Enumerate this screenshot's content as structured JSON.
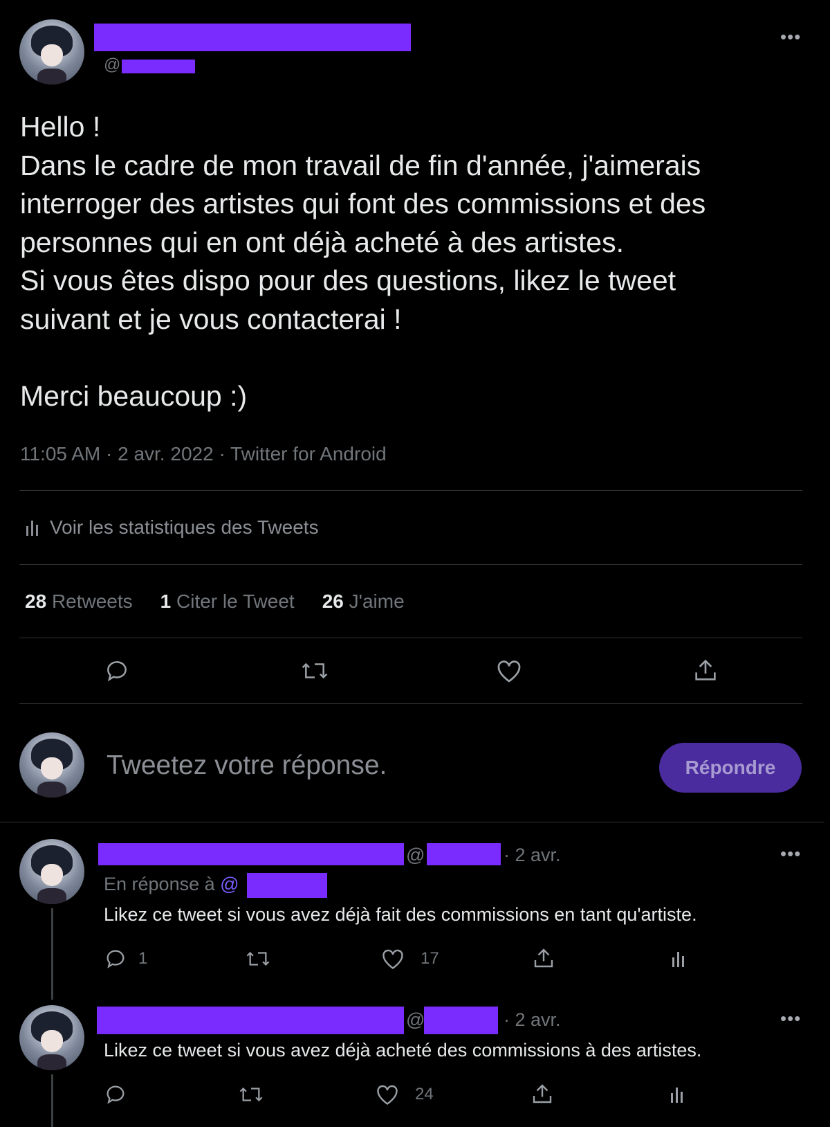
{
  "main_tweet": {
    "handle_prefix": "@",
    "body_lines": [
      "Hello !",
      "Dans le cadre de mon travail de fin d'année, j'aimerais",
      "interroger des artistes qui font des commissions et des",
      "personnes qui en ont déjà acheté à des artistes.",
      "Si vous êtes dispo pour des questions, likez le tweet",
      "suivant et je vous contacterai !",
      "",
      "Merci beaucoup :)"
    ],
    "meta": "11:05 AM · 2 avr. 2022 · Twitter for Android",
    "stats_link": "Voir les statistiques des Tweets",
    "counts": {
      "retweets_num": "28",
      "retweets_label": "Retweets",
      "quotes_num": "1",
      "quotes_label": "Citer le Tweet",
      "likes_num": "26",
      "likes_label": "J'aime"
    }
  },
  "reply_box": {
    "placeholder": "Tweetez votre réponse.",
    "button_label": "Répondre"
  },
  "replies": [
    {
      "at": "@",
      "date": "· 2 avr.",
      "in_reply_prefix": "En réponse à",
      "in_reply_at": "@",
      "text": "Likez ce tweet si vous avez déjà fait des commissions en tant qu'artiste.",
      "reply_count": "1",
      "like_count": "17"
    },
    {
      "at": "@",
      "date": "· 2 avr.",
      "text": "Likez ce tweet si vous avez déjà acheté des commissions à des artistes.",
      "like_count": "24"
    }
  ],
  "colors": {
    "redaction": "#7a2cff",
    "button_bg": "#4b2c9e",
    "button_text": "#a79bd1",
    "mention": "#7a5cff"
  }
}
